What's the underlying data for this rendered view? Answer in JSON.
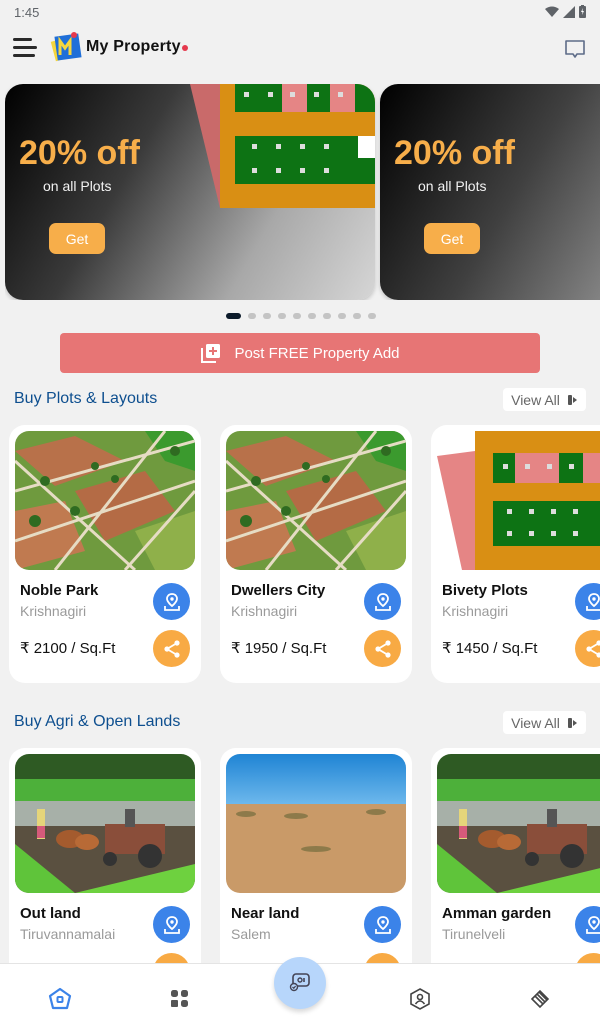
{
  "status_bar": {
    "time": "1:45",
    "icons": [
      "wifi-icon",
      "signal-icon",
      "battery-charging-icon"
    ]
  },
  "app_bar": {
    "app_name": "My Property",
    "menu_icon": "hamburger-menu-icon",
    "chat_icon": "chat-bubble-icon"
  },
  "banners": [
    {
      "title": "20% off",
      "subtitle": "on all Plots",
      "button": "Get"
    },
    {
      "title": "20% off",
      "subtitle": "on all Plots",
      "button": "Get"
    }
  ],
  "carousel": {
    "total": 10,
    "active_index": 0
  },
  "post_button": {
    "label": "Post FREE Property Add",
    "icon": "add-to-library-icon"
  },
  "sections": [
    {
      "title": "Buy Plots & Layouts",
      "view_all": "View All",
      "items": [
        {
          "name": "Noble Park",
          "location": "Krishnagiri",
          "price": "₹ 2100 / Sq.Ft",
          "image": "aerial-plots-photo"
        },
        {
          "name": "Dwellers City",
          "location": "Krishnagiri",
          "price": "₹ 1950 / Sq.Ft",
          "image": "aerial-plots-photo"
        },
        {
          "name": "Bivety Plots",
          "location": "Krishnagiri",
          "price": "₹ 1450 / Sq.Ft",
          "image": "layout-plan"
        }
      ]
    },
    {
      "title": "Buy Agri & Open Lands",
      "view_all": "View All",
      "items": [
        {
          "name": "Out land",
          "location": "Tiruvannamalai",
          "image": "farm-tractor-photo"
        },
        {
          "name": "Near land",
          "location": "Salem",
          "image": "desert-land-photo"
        },
        {
          "name": "Amman garden",
          "location": "Tirunelveli",
          "image": "farm-tractor-photo"
        }
      ]
    }
  ],
  "bottom_nav": [
    {
      "name": "home",
      "icon": "home-icon",
      "active": true
    },
    {
      "name": "categories",
      "icon": "grid-icon",
      "active": false
    },
    {
      "name": "center",
      "icon": "property-card-icon",
      "active": false
    },
    {
      "name": "profile",
      "icon": "profile-icon",
      "active": false
    },
    {
      "name": "layers",
      "icon": "layers-icon",
      "active": false
    }
  ],
  "colors": {
    "accent_orange": "#f7ae4a",
    "primary_blue": "#3b83e9",
    "post_red": "#e77575",
    "section_title": "#0e4f8f",
    "active_nav": "#3b83e9"
  }
}
